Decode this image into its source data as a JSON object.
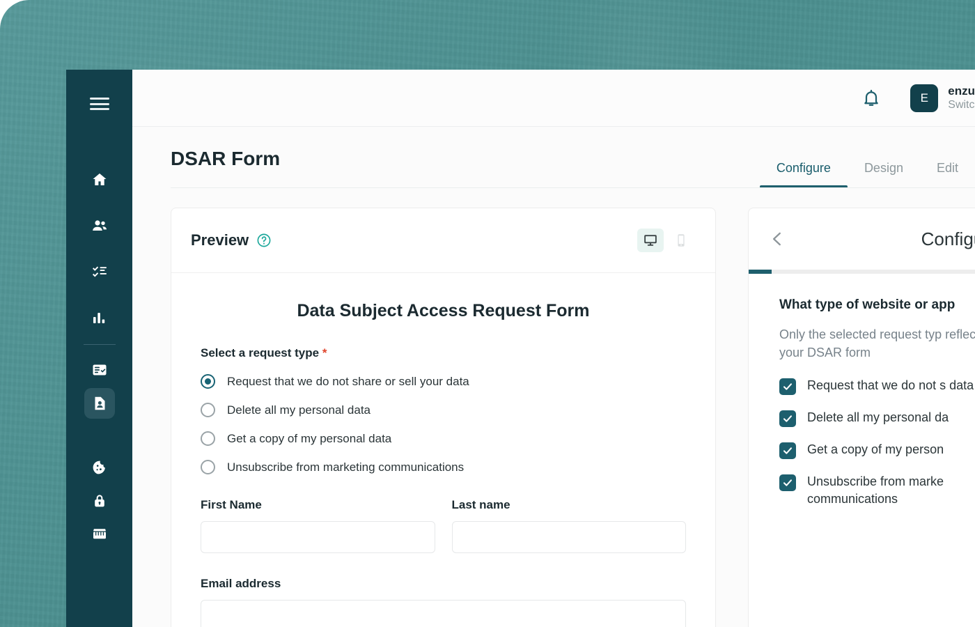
{
  "app": {
    "title": "DSAR Form"
  },
  "sidebar": {
    "menu_icon": "hamburger-menu-icon",
    "items": [
      {
        "icon": "home-icon",
        "name": "home"
      },
      {
        "icon": "people-icon",
        "name": "people"
      },
      {
        "icon": "checklist-icon",
        "name": "tasks"
      },
      {
        "icon": "bar-chart-icon",
        "name": "analytics"
      },
      {
        "icon": "form-check-icon",
        "name": "forms"
      },
      {
        "icon": "document-person-icon",
        "name": "dsar-requests",
        "active": true
      },
      {
        "icon": "cookie-icon",
        "name": "cookies"
      },
      {
        "icon": "lock-icon",
        "name": "privacy"
      },
      {
        "icon": "storefront-icon",
        "name": "store"
      }
    ]
  },
  "topbar": {
    "notifications_icon": "bell-icon",
    "account": {
      "avatar_initial": "E",
      "name": "enzu",
      "subtitle": "Switc"
    }
  },
  "tabs": [
    {
      "label": "Configure",
      "active": true
    },
    {
      "label": "Design",
      "active": false
    },
    {
      "label": "Edit",
      "active": false
    }
  ],
  "preview": {
    "label": "Preview",
    "help_icon": "question-circle-icon",
    "views": [
      {
        "name": "desktop",
        "icon": "desktop-icon",
        "active": true
      },
      {
        "name": "mobile",
        "icon": "mobile-icon",
        "active": false
      }
    ],
    "form": {
      "title": "Data Subject Access Request Form",
      "request_type_label": "Select a request type",
      "required_marker": "*",
      "options": [
        {
          "label": "Request that we do not share or sell your data",
          "selected": true
        },
        {
          "label": "Delete all my personal data",
          "selected": false
        },
        {
          "label": "Get a copy of my personal data",
          "selected": false
        },
        {
          "label": "Unsubscribe from marketing communications",
          "selected": false
        }
      ],
      "first_name_label": "First Name",
      "first_name_value": "",
      "last_name_label": "Last name",
      "last_name_value": "",
      "email_label": "Email address",
      "email_value": ""
    }
  },
  "configure_panel": {
    "back_icon": "chevron-left-icon",
    "title": "Configure",
    "question": "What type of website or app",
    "description": "Only the selected request typ reflected in your DSAR form",
    "checkboxes": [
      {
        "label": "Request that we do not s data",
        "checked": true
      },
      {
        "label": "Delete all my personal da",
        "checked": true
      },
      {
        "label": "Get a copy of my person",
        "checked": true
      },
      {
        "label": "Unsubscribe from marke communications",
        "checked": true
      }
    ]
  },
  "colors": {
    "backdrop_teal": "#4e9292",
    "sidebar_dark": "#12404b",
    "accent_teal": "#1e5f6d",
    "help_green": "#1aa79a",
    "required_red": "#e0452c",
    "muted_text": "#8d989c"
  }
}
